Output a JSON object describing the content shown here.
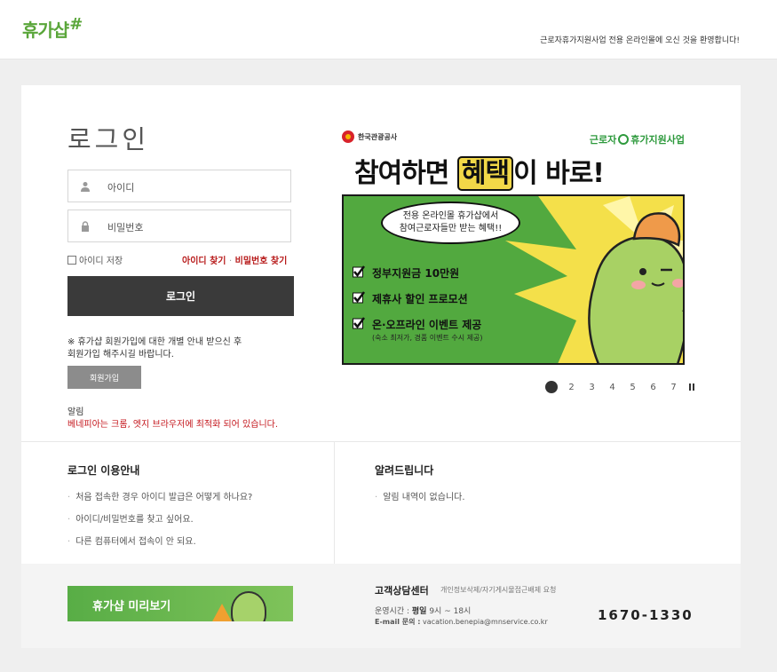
{
  "header": {
    "logo_text": "휴가샵",
    "logo_mark": "#",
    "welcome": "근로자휴가지원사업 전용 온라인몰에 오신 것을 환영합니다!"
  },
  "login": {
    "title": "로그인",
    "id_placeholder": "아이디",
    "pw_placeholder": "비밀번호",
    "save_id_label": "아이디 저장",
    "find_id": "아이디 찾기",
    "link_separator": "·",
    "find_pw": "비밀번호 찾기",
    "submit_label": "로그인",
    "join_note_1": "※ 휴가샵 회원가입에 대한 개별 안내 받으신 후",
    "join_note_2": "회원가입 해주시길 바랍니다.",
    "join_button": "회원가입",
    "notice_title": "알림",
    "notice_text": "베네피아는 크롬, 엣지 브라우저에 최적화 되어 있습니다."
  },
  "banner": {
    "org": "한국관광공사",
    "program_left": "근로자",
    "program_right": "휴가지원사업",
    "headline_pre": "참여하면 ",
    "headline_highlight": "혜택",
    "headline_post": "이 바로!",
    "bubble_line1": "전용 온라인몰 휴가샵에서",
    "bubble_line2": "참여근로자들만 받는 혜택!!",
    "bullets": [
      {
        "text": "정부지원금 10만원",
        "sub": ""
      },
      {
        "text": "제휴사 할인 프로모션",
        "sub": ""
      },
      {
        "text": "온·오프라인 이벤트 제공",
        "sub": "(숙소 최저가, 경품 이벤트 수시 제공)"
      }
    ]
  },
  "pager": {
    "pages": [
      "2",
      "3",
      "4",
      "5",
      "6",
      "7"
    ],
    "active_page": 1
  },
  "guide": {
    "title": "로그인 이용안내",
    "items": [
      "처음 접속한 경우 아이디 발급은 어떻게 하나요?",
      "아이디/비밀번호를 찾고 싶어요.",
      "다른 컴퓨터에서 접속이 안 되요."
    ]
  },
  "news": {
    "title": "알려드립니다",
    "items": [
      "알림 내역이 없습니다."
    ]
  },
  "footer": {
    "preview_label": "휴가샵 미리보기",
    "cs_title": "고객상담센터",
    "cs_sub": "개인정보삭제/자기게시물접근배제 요청",
    "hours_label": "운영시간 :",
    "hours_days": "평일",
    "hours_time": "9시 ~ 18시",
    "email_label": "E-mail 문의 :",
    "email": "vacation.benepia@mnservice.co.kr",
    "phone": "1670-1330"
  },
  "colors": {
    "brand_green": "#5aa63a",
    "alert_red": "#c4161c",
    "button_dark": "#3a3a3a",
    "panel_green": "#52a93f",
    "highlight_yellow": "#f2d848"
  }
}
